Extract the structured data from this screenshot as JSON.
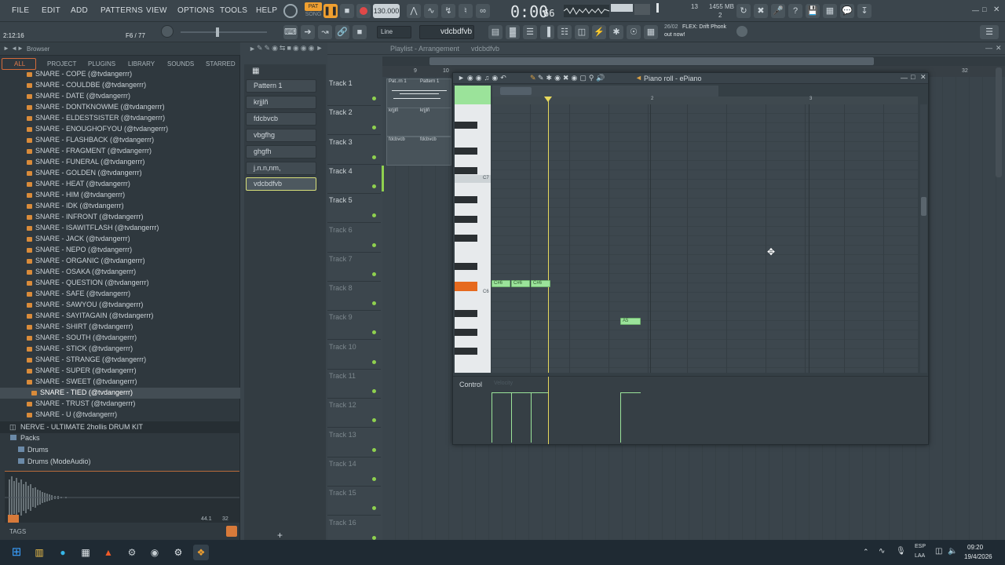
{
  "menu": [
    "FILE",
    "EDIT",
    "ADD",
    "PATTERNS",
    "VIEW",
    "OPTIONS",
    "TOOLS",
    "HELP"
  ],
  "transport": {
    "pat_label": "PAT",
    "song_label": "SONG",
    "tempo": "130.000",
    "time": "0:00",
    "time_frames": "66"
  },
  "cpu": {
    "voices": "13",
    "memory": "1455 MB",
    "polyphony": "2"
  },
  "hint_bar": {
    "position": "2:12:16",
    "pattern_info": "F6 / 77"
  },
  "snap": {
    "mode": "Line",
    "pattern": "vdcbdfvb"
  },
  "news": {
    "date": "26/02",
    "line1": "FLEX: Drift Phonk",
    "line2": "out now!"
  },
  "browser": {
    "title": "Browser",
    "tabs": [
      "ALL",
      "PROJECT",
      "PLUGINS",
      "LIBRARY",
      "SOUNDS",
      "STARRED"
    ],
    "items": [
      "SNARE - COPE (@tvdangerrr)",
      "SNARE - COULDBE (@tvdangerrr)",
      "SNARE - DATE (@tvdangerrr)",
      "SNARE - DONTKNOWME (@tvdangerrr)",
      "SNARE - ELDESTSISTER (@tvdangerrr)",
      "SNARE - ENOUGHOFYOU (@tvdangerrr)",
      "SNARE - FLASHBACK (@tvdangerrr)",
      "SNARE - FRAGMENT (@tvdangerrr)",
      "SNARE - FUNERAL (@tvdangerrr)",
      "SNARE - GOLDEN (@tvdangerrr)",
      "SNARE - HEAT (@tvdangerrr)",
      "SNARE - HIM (@tvdangerrr)",
      "SNARE - IDK (@tvdangerrr)",
      "SNARE - INFRONT (@tvdangerrr)",
      "SNARE - ISAWITFLASH (@tvdangerrr)",
      "SNARE - JACK (@tvdangerrr)",
      "SNARE - NEPO (@tvdangerrr)",
      "SNARE - ORGANIC (@tvdangerrr)",
      "SNARE - OSAKA (@tvdangerrr)",
      "SNARE - QUESTION (@tvdangerrr)",
      "SNARE - SAFE (@tvdangerrr)",
      "SNARE - SAWYOU (@tvdangerrr)",
      "SNARE - SAYITAGAIN (@tvdangerrr)",
      "SNARE - SHIRT (@tvdangerrr)",
      "SNARE - SOUTH (@tvdangerrr)",
      "SNARE - STICK (@tvdangerrr)",
      "SNARE - STRANGE (@tvdangerrr)",
      "SNARE - SUPER (@tvdangerrr)",
      "SNARE - SWEET (@tvdangerrr)",
      "SNARE - TIED (@tvdangerrr)",
      "SNARE - TRUST (@tvdangerrr)",
      "SNARE - U (@tvdangerrr)"
    ],
    "selected_item": "SNARE - TIED (@tvdangerrr)",
    "kit_title": "NERVE - ULTIMATE 2hollis DRUM KIT",
    "packs_label": "Packs",
    "packs": [
      "Drums",
      "Drums (ModeAudio)"
    ],
    "sample_info": "44.1",
    "sample_info2": "32",
    "tags_label": "TAGS"
  },
  "channels": [
    "Pattern 1",
    "krjjlñ",
    "fdcbvcb",
    "vbgfhg",
    "ghgfh",
    "j.n.n,nm,",
    "vdcbdfvb"
  ],
  "playlist": {
    "title": "Playlist - Arrangement",
    "pattern": "vdcbdfvb",
    "tracks": [
      "Track 1",
      "Track 2",
      "Track 3",
      "Track 4",
      "Track 5",
      "Track 6",
      "Track 7",
      "Track 8",
      "Track 9",
      "Track 10",
      "Track 11",
      "Track 12",
      "Track 13",
      "Track 14",
      "Track 15",
      "Track 16"
    ],
    "clip_patterns": [
      "Pat..rn 1",
      "Pattern 1",
      "krjjlñ",
      "krjjlñ",
      "fdcbvcb",
      "fdcbvcb"
    ],
    "ruler": [
      "9",
      "10"
    ],
    "ruler_far": "32"
  },
  "piano_roll": {
    "title": "Piano roll - ePiano",
    "bar_marks": [
      "2",
      "3"
    ],
    "octave_labels": [
      "C7",
      "C6"
    ],
    "notes": [
      {
        "label": "C#6"
      },
      {
        "label": "C#6"
      },
      {
        "label": "C#6"
      },
      {
        "label": "A5"
      }
    ],
    "control_label": "Control",
    "control_target": "Velocity"
  },
  "taskbar": {
    "lang1": "ESP",
    "lang2": "LAA",
    "time": "09:20",
    "date": "19/4/2026"
  },
  "colors": {
    "accent": "#f0a030",
    "note": "#9be39a",
    "playhead": "#e7d95c",
    "led": "#8fd14f"
  }
}
